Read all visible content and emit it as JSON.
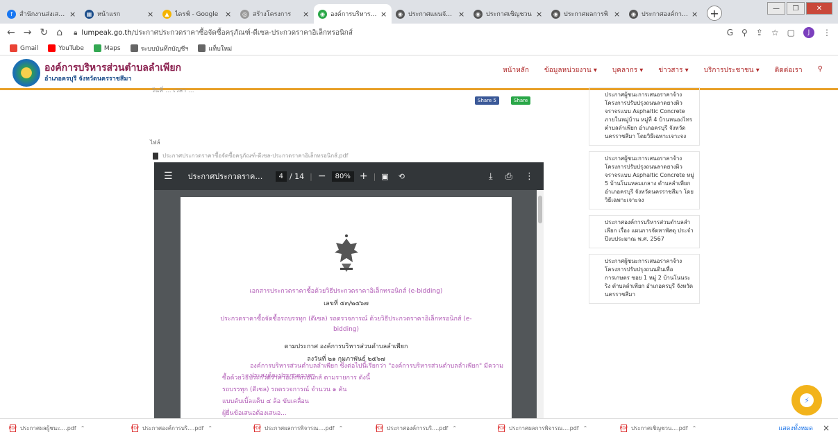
{
  "browser": {
    "tabs": [
      {
        "title": "สำนักงานส่งเสริมฯ",
        "fav_color": "#1877f2",
        "fav": "f"
      },
      {
        "title": "หน้าแรก",
        "fav_color": "#1b4d8a",
        "fav": "▦"
      },
      {
        "title": "ไดรฟ์ - Google",
        "fav_color": "#f4b400",
        "fav": "▲"
      },
      {
        "title": "สร้างโครงการ",
        "fav_color": "#999999",
        "fav": "◎"
      },
      {
        "title": "องค์การบริหารส่วน",
        "fav_color": "#2aa748",
        "fav": "◉"
      },
      {
        "title": "ประกาศแผนจัดซื้อ",
        "fav_color": "#555555",
        "fav": "◉"
      },
      {
        "title": "ประกาศเชิญชวน",
        "fav_color": "#555555",
        "fav": "◉"
      },
      {
        "title": "ประกาศผลการพิ",
        "fav_color": "#555555",
        "fav": "◉"
      },
      {
        "title": "ประกาศองค์การบ",
        "fav_color": "#555555",
        "fav": "◉"
      }
    ],
    "active_tab": 4,
    "new_tab": "+",
    "url_domain": "lumpeak.go.th",
    "url_path": "/ประกาศประกวดราคาซื้อจัดซื้อครุภัณฑ์-ดีเซล-ประกวดราคาอิเล็กทรอนิกส์",
    "profile_initial": "J",
    "bookmarks": [
      {
        "label": "Gmail",
        "color": "#ea4335"
      },
      {
        "label": "YouTube",
        "color": "#ff0000"
      },
      {
        "label": "Maps",
        "color": "#34a853"
      },
      {
        "label": "ระบบบันทึกบัญชีฯ",
        "color": "#666666"
      },
      {
        "label": "แท็บใหม่",
        "color": "#666666"
      }
    ]
  },
  "site": {
    "org_name": "องค์การบริหารส่วนตำบลลำเพียก",
    "org_sub": "อำเภอครบุรี จังหวัดนครราชสีมา",
    "menu": [
      "หน้าหลัก",
      "ข้อมูลหน่วยงาน ▾",
      "บุคลากร ▾",
      "ข่าวสาร ▾",
      "บริการประชาชน ▾",
      "ติดต่อเรา",
      "⚲"
    ]
  },
  "article": {
    "meta": "วันที่ ... เวลา ...",
    "share_fb": "Share 5",
    "share_line": "Share",
    "label": "ไฟล์",
    "file_name": "ประกาศประกวดราคาซื้อจัดซื้อครุภัณฑ์-ดีเซล-ประกวดราคาอิเล็กทรอนิกส์.pdf"
  },
  "pdf_viewer": {
    "doc_title": "ประกาศประกวดราคาซื้...",
    "page_current": "4",
    "page_total": "/ 14",
    "zoom": "80%",
    "lines": [
      {
        "text": "เอกสารประกวดราคาซื้อด้วยวิธีประกวดราคาอิเล็กทรอนิกส์ (e-bidding)",
        "style": "p"
      },
      {
        "text": "เลขที่ ๕๓/๒๕๖๗",
        "style": "b"
      },
      {
        "text": "ประกวดราคาซื้อจัดซื้อรถบรรทุก (ดีเซล) รถตรวจการณ์ ด้วยวิธีประกวดราคาอิเล็กทรอนิกส์ (e-",
        "style": "p"
      },
      {
        "text": "bidding)",
        "style": "p"
      },
      {
        "text": "ตามประกาศ องค์การบริหารส่วนตำบลลำเพียก",
        "style": "b"
      },
      {
        "text": "ลงวันที่ ๒๑ กุมภาพันธ์ ๒๕๖๗",
        "style": "b"
      }
    ],
    "body": [
      "องค์การบริหารส่วนตำบลลำเพียก ซึ่งต่อไปนี้เรียกว่า \"องค์การบริหารส่วนตำบลลำเพียก\" มีความประสงค์จะประกวดราคา",
      "ซื้อด้วยวิธีประกวดราคาอิเล็กทรอนิกส์ ตามรายการ ดังนี้",
      "รถบรรทุก (ดีเซล) รถตรวจการณ์        จำนวน      ๑      คัน",
      "แบบดับเบิ้ลแค็บ ๔ ล้อ ขับเคลื่อน",
      "ผู้ยื่นข้อเสนอต้องเสนอ..."
    ]
  },
  "sidebar_news": [
    "ประกาศผู้ชนะการเสนอราคาจ้างโครงการปรับปรุงถนนลาดยางผิวจราจรแบบ Asphaltic Concrete ภายในหมู่บ้าน หมู่ที่ 4 บ้านหนองไทร ตำบลลำเพียก อำเภอครบุรี จังหวัดนครราชสีมา โดยวิธีเฉพาะเจาะจง",
    "ประกาศผู้ชนะการเสนอราคาจ้างโครงการปรับปรุงถนนลาดยางผิวจราจรแบบ Asphaltic Concrete หมู่ 5 บ้านโนนหลมเกลาง ตำบลลำเพียก อำเภอครบุรี จังหวัดนครราชสีมา โดยวิธีเฉพาะเจาะจง",
    "ประกาศองค์การบริหารส่วนตำบลลำเพียก เรื่อง แผนการจัดหาพัสดุ ประจำปีงบประมาณ พ.ศ. 2567",
    "ประกาศผู้ชนะการเสนอราคาจ้างโครงการปรับปรุงถนนดินเพื่อการเกษตร ซอย 1 หมู่ 2 บ้านโนนระริง ตำบลลำเพียก อำเภอครบุรี จังหวัดนครราชสีมา"
  ],
  "downloads": {
    "items": [
      "ประกาศผลผู้ชนะ....pdf",
      "ประกาศองค์การบริ....pdf",
      "ประกาศผลการพิจารณ....pdf",
      "ประกาศองค์การบริ....pdf",
      "ประกาศผลการพิจารณ....pdf",
      "ประกาศเชิญชวน....pdf"
    ],
    "show_all": "แสดงทั้งหมด",
    "close": "×"
  },
  "chat": {
    "icon": "messenger-icon"
  }
}
